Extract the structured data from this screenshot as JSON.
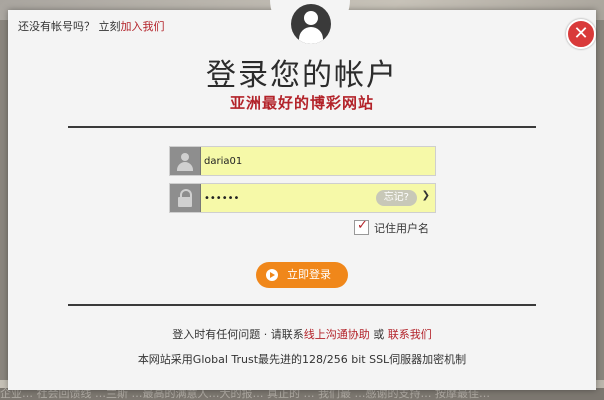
{
  "background": {
    "footer_text": "企业… 社会回馈线  …兰斯 …最高的满意人…大的报… 真正的 … 我们最 …感谢的支持… 按摩最佳…"
  },
  "modal": {
    "top_note_prefix": "还没有帐号吗？ 立刻",
    "top_note_link": "加入我们",
    "close_symbol": "✕",
    "title": "登录您的帐户",
    "subtitle": "亚洲最好的博彩网站",
    "username_value": "daria01",
    "password_value": "••••••",
    "forgot_label": "忘记?",
    "remember_label": "记住用户名",
    "remember_checked": true,
    "login_label": "立即登录",
    "help_prefix": "登入时有任何问题 · 请联系",
    "help_link1": "线上沟通协助",
    "help_mid": " 或 ",
    "help_link2": "联系我们",
    "secure_text": "本网站采用Global Trust最先进的128/256 bit SSL伺服器加密机制"
  },
  "colors": {
    "accent_red": "#b3232a",
    "button_orange": "#f0871a",
    "field_yellow": "#f6f9a8",
    "close_red": "#d93a3a"
  }
}
